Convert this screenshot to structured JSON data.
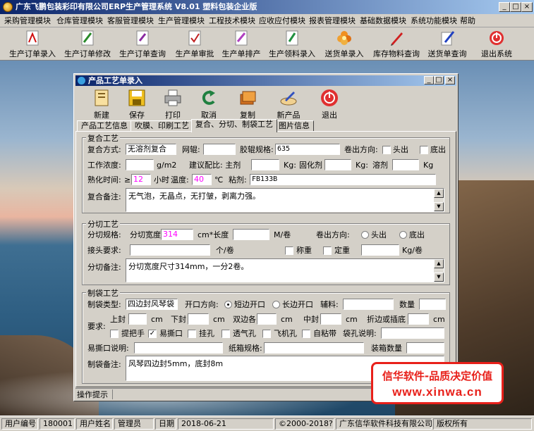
{
  "window": {
    "title": "广东飞鹏包装彩印有限公司ERP生产管理系统  V8.01  塑料包装企业版"
  },
  "menu": [
    "采购管理模块",
    "仓库管理模块",
    "客服管理模块",
    "生产管理模块",
    "工程技术模块",
    "应收应付模块",
    "报表管理模块",
    "基础数据模块",
    "系统功能模块",
    "帮助"
  ],
  "toolbar": [
    "生产订单录入",
    "生产订单修改",
    "生产订单查询",
    "生产单审批",
    "生产单排产",
    "生产领料录入",
    "送货单录入",
    "库存物料查询",
    "送货单查询",
    "退出系统"
  ],
  "child": {
    "title": "产品工艺单录入",
    "buttons": [
      "新建",
      "保存",
      "打印",
      "取消",
      "复制",
      "新产品",
      "退出"
    ],
    "tabs": [
      "产品工艺信息",
      "吹膜、印刷工艺",
      "复合、分切、制袋工艺",
      "图片信息"
    ],
    "status": "操作提示"
  },
  "fuhe": {
    "legend": "复合工艺",
    "method_label": "复合方式:",
    "method_value": "无溶剂复合",
    "mesh_label": "网辊:",
    "roller_spec_label": "胶辊规格:",
    "roller_spec_value": "635",
    "direction_label": "卷出方向:",
    "head_label": "头出",
    "bottom_label": "底出",
    "concentration_label": "工作浓度:",
    "unit_gm2": "g/m2",
    "ratio_label": "建议配比:  主剂",
    "unit_kg1": "Kg:",
    "curing_label": "固化剂",
    "unit_kg2": "Kg:",
    "solvent_label": "溶剂",
    "unit_kg3": "Kg",
    "aging_label": "熟化时间:",
    "aging_prefix": "≥",
    "aging_value": "12",
    "hours_label": "小时",
    "temp_label": "温度:",
    "temp_value": "40",
    "temp_unit": "℃",
    "adhesive_label": "粘剂:",
    "adhesive_value": "FB133B",
    "remark_label": "复合备注:",
    "remark_value": "无气泡，无晶点，无打皱，剥离力强。"
  },
  "fenqie": {
    "legend": "分切工艺",
    "spec_label": "分切规格:",
    "width_label": "分切宽度",
    "width_value": "314",
    "length_label": "cm*长度",
    "unit_mroll": "M/卷",
    "direction_label": "卷出方向:",
    "head_label": "头出",
    "bottom_label": "底出",
    "joint_label": "接头要求:",
    "unit_per_roll": "个/卷",
    "weigh_label": "称重",
    "fixed_label": "定重",
    "unit_kg_roll": "Kg/卷",
    "remark_label": "分切备注:",
    "remark_value": "分切宽度尺寸314mm，一分2卷。"
  },
  "zhidai": {
    "legend": "制袋工艺",
    "type_label": "制袋类型:",
    "type_value": "四边封风琴袋",
    "open_label": "开口方向:",
    "short_open": "短边开口",
    "long_open": "长边开口",
    "aux_label": "辅料:",
    "qty_label": "数量",
    "req_label": "要求:",
    "top_seal": "上封",
    "cm1": "cm",
    "bottom_seal": "下封",
    "cm2": "cm",
    "double_edge": "双边各",
    "cm3": "cm",
    "middle_seal": "中封",
    "cm4": "cm",
    "fold_label": "折边或插底",
    "cm5": "cm",
    "handle_label": "提把手",
    "tear_label": "易撕口",
    "hang_label": "挂孔",
    "vent_label": "透气孔",
    "airplane_label": "飞机孔",
    "zip_label": "自粘带",
    "hole_desc_label": "袋孔说明:",
    "tear_desc_label": "易撕口说明:",
    "carton_label": "纸箱规格:",
    "box_qty_label": "装箱数量",
    "remark_label": "制袋备注:",
    "remark_value": "风琴四边封5mm，底封8m"
  },
  "stamp": {
    "line1": "信华软件-品质决定价值",
    "line2": "www.xinwa.cn"
  },
  "statusbar": [
    "用户编号",
    "180001",
    "用户姓名",
    "管理员",
    "日期",
    "2018-06-21",
    "©2000-2018?",
    "广东信华软件科技有限公司",
    "版权所有"
  ]
}
